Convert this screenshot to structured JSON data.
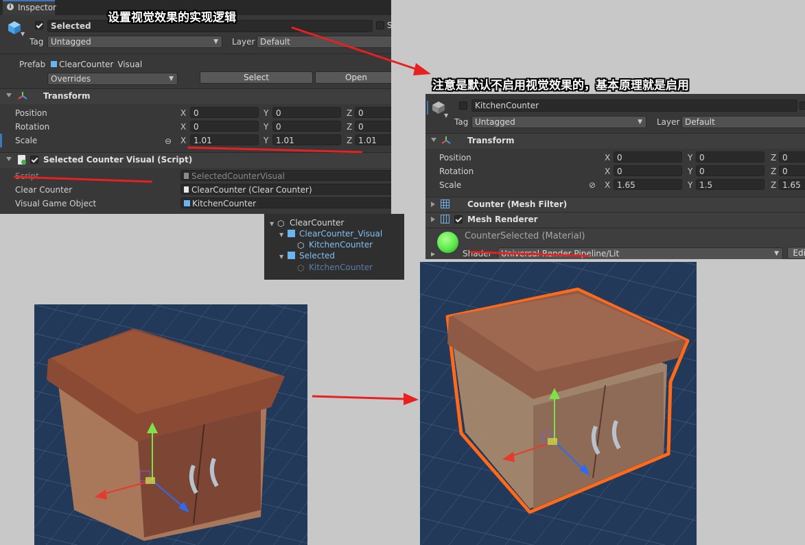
{
  "annotations": {
    "top": "设置视觉效果的实现逻辑",
    "right": "注意是默认不启用视觉效果的，基本原理就是启用"
  },
  "inspector1": {
    "tab": "Inspector",
    "object_name": "Selected",
    "static_partial": "S",
    "tag_label": "Tag",
    "tag_value": "Untagged",
    "layer_label": "Layer",
    "layer_value": "Default",
    "prefab_label": "Prefab",
    "prefab_value": "ClearCounter_Visual",
    "overrides": "Overrides",
    "select_btn": "Select",
    "open_btn": "Open",
    "transform": {
      "title": "Transform",
      "position_label": "Position",
      "rotation_label": "Rotation",
      "scale_label": "Scale",
      "x": "X",
      "y": "Y",
      "z": "Z",
      "position": [
        "0",
        "0",
        "0"
      ],
      "rotation": [
        "0",
        "0",
        "0"
      ],
      "scale": [
        "1.01",
        "1.01",
        "1.01"
      ]
    },
    "script_component": {
      "title": "Selected Counter Visual (Script)",
      "script_label": "Script",
      "script_value": "SelectedCounterVisual",
      "clear_counter_label": "Clear Counter",
      "clear_counter_value": "ClearCounter (Clear Counter)",
      "visual_label": "Visual Game Object",
      "visual_value": "KitchenCounter"
    }
  },
  "hierarchy": {
    "items": [
      "ClearCounter",
      "ClearCounter_Visual",
      "KitchenCounter",
      "Selected",
      "KitchenCounter"
    ]
  },
  "inspector2": {
    "object_name": "KitchenCounter",
    "tag_label": "Tag",
    "tag_value": "Untagged",
    "layer_label": "Layer",
    "layer_value": "Default",
    "transform": {
      "title": "Transform",
      "position_label": "Position",
      "rotation_label": "Rotation",
      "scale_label": "Scale",
      "x": "X",
      "y": "Y",
      "z": "Z",
      "position": [
        "0",
        "0",
        "0"
      ],
      "rotation": [
        "0",
        "0",
        "0"
      ],
      "scale": [
        "1.65",
        "1.5",
        "1.65"
      ]
    },
    "mesh_filter": "Counter (Mesh Filter)",
    "mesh_renderer": "Mesh Renderer",
    "material_name": "CounterSelected",
    "material_suffix": "(Material)",
    "shader_label": "Shader",
    "shader_value": "Universal Render Pipeline/Lit",
    "edit_btn": "Edit"
  },
  "colors": {
    "annotation_arrow": "#e8201f",
    "underline": "#e8201f",
    "selection_outline": "#ff6a1a",
    "material_preview": "#5be84a",
    "prefab_blue": "#6ab4f0"
  }
}
